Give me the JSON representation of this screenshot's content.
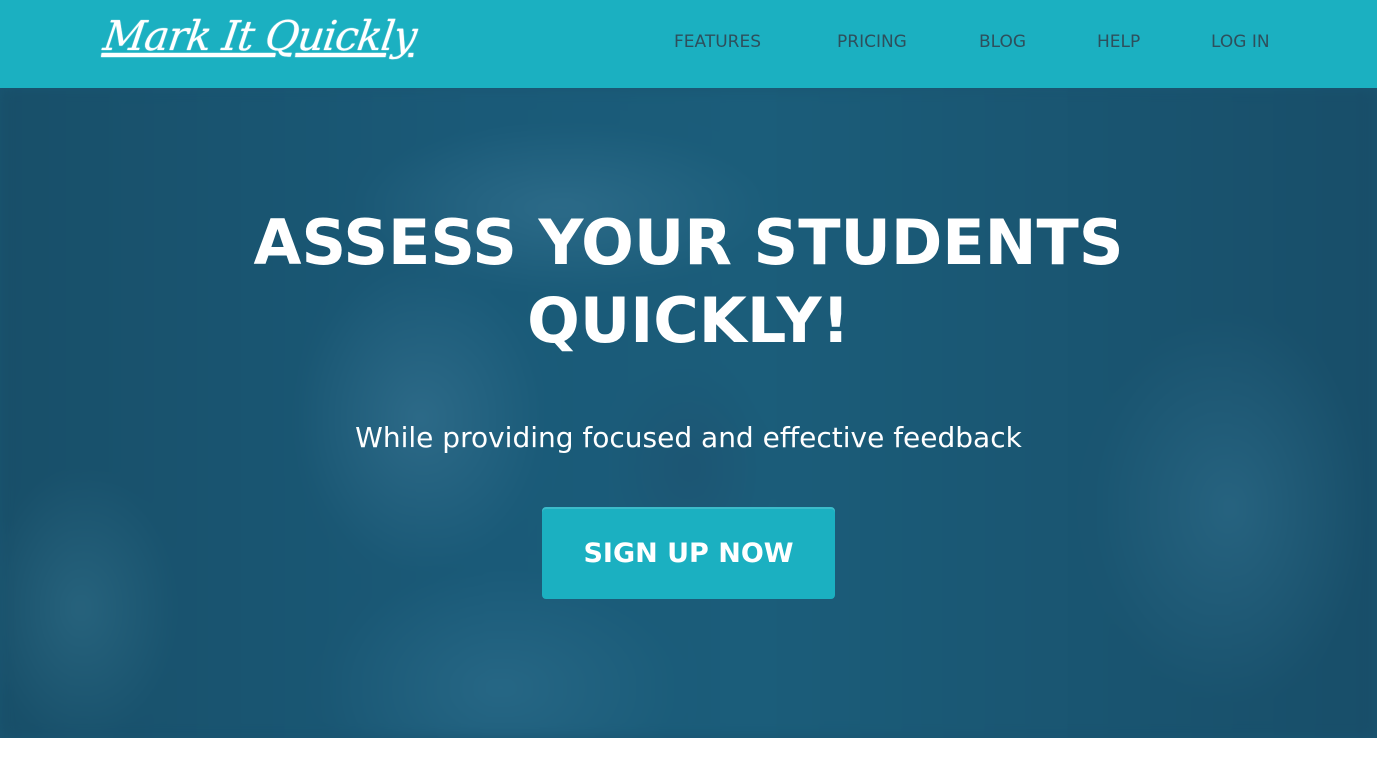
{
  "colors": {
    "nav_background": "#1bb0c1",
    "nav_link": "#2e4f5c",
    "hero_overlay": "#1a5571",
    "cta_background": "#1bb0c1",
    "text_light": "#ffffff"
  },
  "header": {
    "logo_text": "Mark It Quickly",
    "nav": [
      {
        "label": "FEATURES"
      },
      {
        "label": "PRICING"
      },
      {
        "label": "BLOG"
      },
      {
        "label": "HELP"
      },
      {
        "label": "LOG IN"
      }
    ]
  },
  "hero": {
    "title_line1": "ASSESS YOUR STUDENTS",
    "title_line2": "QUICKLY!",
    "subtitle": "While providing focused and effective feedback",
    "cta_label": "SIGN UP NOW"
  }
}
